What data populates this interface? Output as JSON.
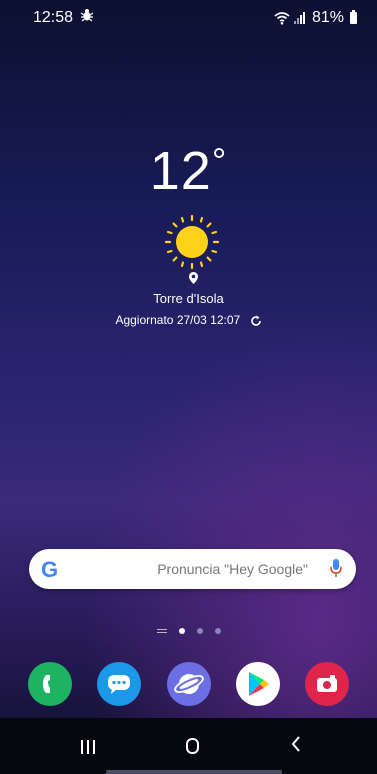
{
  "status_bar": {
    "time": "12:58",
    "battery": "81%",
    "icons": [
      "bug-icon",
      "wifi-icon",
      "signal-icon",
      "battery-icon"
    ]
  },
  "weather": {
    "temperature": "12",
    "degree_symbol": "°",
    "condition_icon": "sun-icon",
    "location": "Torre d'Isola",
    "updated": "Aggiornato 27/03 12:07"
  },
  "search": {
    "logo": "G",
    "placeholder": "Pronuncia \"Hey Google\""
  },
  "page_indicator": {
    "pages": 3,
    "active": 0
  },
  "dock": {
    "apps": [
      "phone-icon",
      "messages-icon",
      "internet-icon",
      "play-store-icon",
      "camera-icon"
    ],
    "colors": {
      "phone": "#1db362",
      "messages": "#1c98e8",
      "internet": "#6b6fe3",
      "play": "#ffffff",
      "camera": "#e0254b"
    }
  },
  "nav": {
    "buttons": [
      "recents",
      "home",
      "back"
    ]
  }
}
